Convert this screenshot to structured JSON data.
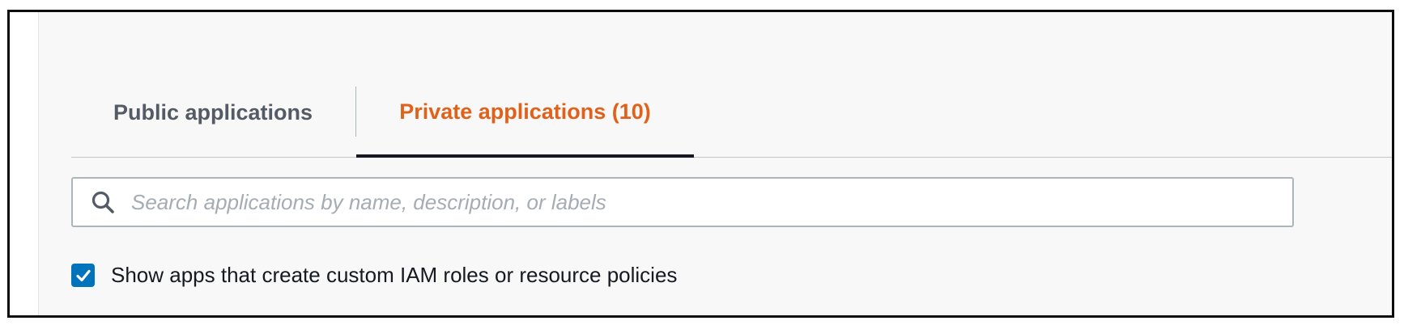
{
  "tabs": {
    "public": {
      "label": "Public applications",
      "selected": false
    },
    "private": {
      "label": "Private applications (10)",
      "selected": true
    }
  },
  "search": {
    "placeholder": "Search applications by name, description, or labels",
    "value": "",
    "icon": "search-icon"
  },
  "filter": {
    "label": "Show apps that create custom IAM roles or resource policies",
    "checked": true,
    "icon": "checkmark-icon"
  },
  "colors": {
    "active_tab": "#e0611a",
    "inactive_tab": "#545b64",
    "checkbox": "#0073bb"
  }
}
